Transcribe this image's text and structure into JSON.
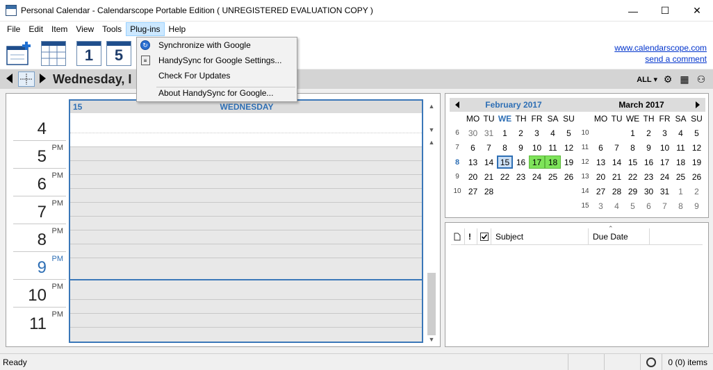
{
  "window": {
    "title": "Personal Calendar - Calendarscope Portable Edition ( UNREGISTERED EVALUATION COPY )",
    "minimize": "—",
    "maximize": "☐",
    "close": "✕"
  },
  "menubar": {
    "items": [
      "File",
      "Edit",
      "Item",
      "View",
      "Tools",
      "Plug-ins",
      "Help"
    ]
  },
  "toolbar": {
    "day1_label": "1",
    "day5_label": "5",
    "website_link": "www.calendarscope.com",
    "comment_link": "send a comment"
  },
  "plugins_menu": {
    "items": [
      "Synchronize with Google",
      "HandySync for Google Settings...",
      "Check For Updates",
      "About HandySync for Google..."
    ]
  },
  "navbar": {
    "date_label": "Wednesday, I",
    "filter": "ALL ▾"
  },
  "dayview": {
    "day_number": "15",
    "day_name": "WEDNESDAY",
    "hours": [
      {
        "hour": "4",
        "ampm": ""
      },
      {
        "hour": "5",
        "ampm": "PM"
      },
      {
        "hour": "6",
        "ampm": "PM"
      },
      {
        "hour": "7",
        "ampm": "PM"
      },
      {
        "hour": "8",
        "ampm": "PM"
      },
      {
        "hour": "9",
        "ampm": "PM"
      },
      {
        "hour": "10",
        "ampm": "PM"
      },
      {
        "hour": "11",
        "ampm": "PM"
      }
    ]
  },
  "mini_calendars": {
    "weekdays": [
      "MO",
      "TU",
      "WE",
      "TH",
      "FR",
      "SA",
      "SU"
    ],
    "months": [
      {
        "title": "February 2017",
        "weeks": [
          {
            "wk": "6",
            "days": [
              "30",
              "31",
              "1",
              "2",
              "3",
              "4",
              "5"
            ]
          },
          {
            "wk": "7",
            "days": [
              "6",
              "7",
              "8",
              "9",
              "10",
              "11",
              "12"
            ]
          },
          {
            "wk": "8",
            "days": [
              "13",
              "14",
              "15",
              "16",
              "17",
              "18",
              "19"
            ]
          },
          {
            "wk": "9",
            "days": [
              "20",
              "21",
              "22",
              "23",
              "24",
              "25",
              "26"
            ]
          },
          {
            "wk": "10",
            "days": [
              "27",
              "28",
              "",
              "",
              "",
              "",
              ""
            ]
          }
        ]
      },
      {
        "title": "March 2017",
        "weeks": [
          {
            "wk": "10",
            "days": [
              "",
              "",
              "1",
              "2",
              "3",
              "4",
              "5"
            ]
          },
          {
            "wk": "11",
            "days": [
              "6",
              "7",
              "8",
              "9",
              "10",
              "11",
              "12"
            ]
          },
          {
            "wk": "12",
            "days": [
              "13",
              "14",
              "15",
              "16",
              "17",
              "18",
              "19"
            ]
          },
          {
            "wk": "13",
            "days": [
              "20",
              "21",
              "22",
              "23",
              "24",
              "25",
              "26"
            ]
          },
          {
            "wk": "14",
            "days": [
              "27",
              "28",
              "29",
              "30",
              "31",
              "1",
              "2"
            ]
          },
          {
            "wk": "15",
            "days": [
              "3",
              "4",
              "5",
              "6",
              "7",
              "8",
              "9"
            ]
          }
        ]
      }
    ]
  },
  "tasks": {
    "col_flag": "!",
    "col_subject": "Subject",
    "col_due": "Due Date"
  },
  "status": {
    "text": "Ready",
    "count": "0 (0) items"
  },
  "colors": {
    "accent": "#2e6fb5",
    "highlight_green": "#7ee35a"
  }
}
